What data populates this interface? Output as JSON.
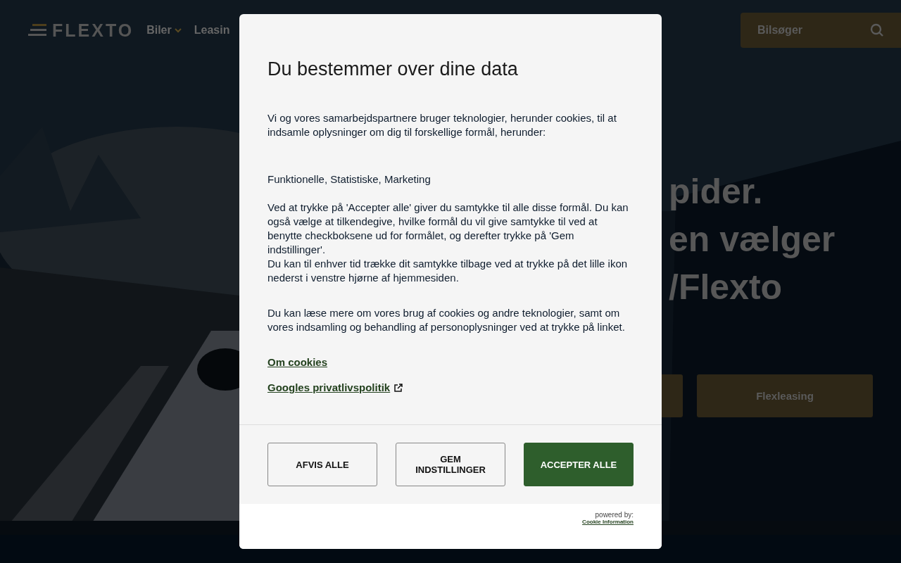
{
  "header": {
    "logo": "FLEXTO",
    "nav": [
      {
        "label": "Biler",
        "has_caret": true
      },
      {
        "label": "Leasin",
        "has_caret": false
      }
    ],
    "search_button": "Bilsøger"
  },
  "hero": {
    "kind": "picture",
    "heading_lines": [
      "pider.",
      "en vælger",
      "/Flexto"
    ],
    "buttons": [
      {
        "kind": "blank"
      },
      {
        "kind": "text",
        "label": "Flexleasing"
      }
    ]
  },
  "cookie_dialog": {
    "title": "Du bestemmer over dine data",
    "intro": "Vi og vores samarbejdspartnere bruger teknologier, herunder cookies, til at indsamle oplysninger om dig til forskellige formål, herunder:",
    "purposes": "Funktionelle, Statistiske, Marketing",
    "consent_text": [
      "Ved at trykke på 'Accepter alle' giver du samtykke til alle disse formål. Du kan også vælge at tilkendegive, hvilke formål du vil give samtykke til ved at benytte checkboksene ud for formålet, og derefter trykke på 'Gem indstillinger'.",
      "Du kan til enhver tid trække dit samtykke tilbage ved at trykke på det lille ikon nederst i venstre hjørne af hjemmesiden."
    ],
    "more_info": "Du kan læse mere om vores brug af cookies og andre teknologier, samt om vores indsamling og behandling af personoplysninger ved at trykke på linket.",
    "links": [
      {
        "label": "Om cookies",
        "external": false
      },
      {
        "label": "Googles privatlivspolitik",
        "external": true
      }
    ],
    "buttons": [
      {
        "label": "AFVIS ALLE",
        "kind": "outline"
      },
      {
        "label": "GEM INDSTILLINGER",
        "kind": "outline"
      },
      {
        "label": "ACCEPTER ALLE",
        "kind": "primary"
      }
    ],
    "powered_by": "powered by:",
    "provider_link": "Cookie Information"
  }
}
